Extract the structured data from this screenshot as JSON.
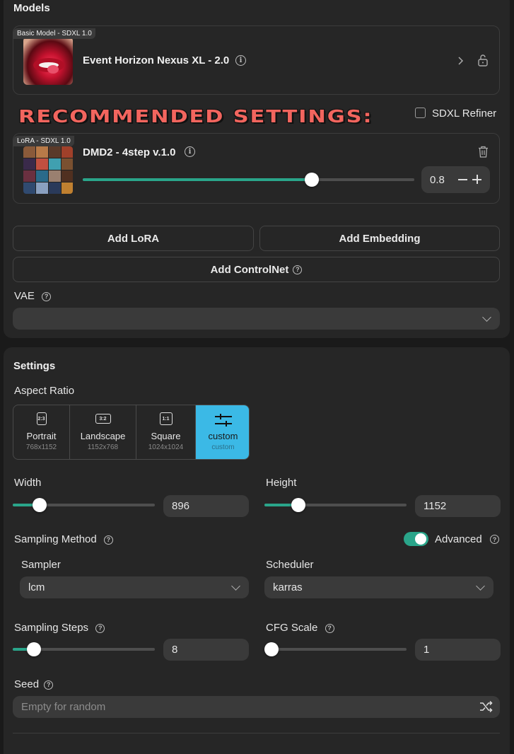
{
  "models": {
    "title": "Models",
    "base_model": {
      "tag": "Basic Model - SDXL 1.0",
      "name": "Event Horizon Nexus XL - 2.0"
    },
    "recommended_banner": "RECOMMENDED SETTINGS:",
    "sdxl_refiner": {
      "label": "SDXL Refiner",
      "checked": false
    },
    "lora": {
      "tag": "LoRA - SDXL 1.0",
      "name": "DMD2 - 4step v.1.0",
      "weight": "0.8",
      "slider_fraction": 0.69
    },
    "buttons": {
      "add_lora": "Add LoRA",
      "add_embedding": "Add Embedding",
      "add_controlnet": "Add ControlNet"
    },
    "vae": {
      "label": "VAE",
      "value": ""
    }
  },
  "settings": {
    "title": "Settings",
    "aspect_ratio": {
      "label": "Aspect Ratio",
      "options": [
        {
          "icon": "2:3",
          "name": "Portrait",
          "dims": "768x1152"
        },
        {
          "icon": "3:2",
          "name": "Landscape",
          "dims": "1152x768"
        },
        {
          "icon": "1:1",
          "name": "Square",
          "dims": "1024x1024"
        },
        {
          "icon": "sliders-icon",
          "name": "custom",
          "dims": "custom"
        }
      ],
      "selected": "custom"
    },
    "width": {
      "label": "Width",
      "value": "896",
      "slider_fraction": 0.19
    },
    "height": {
      "label": "Height",
      "value": "1152",
      "slider_fraction": 0.24
    },
    "sampling_method": {
      "label": "Sampling Method",
      "advanced_label": "Advanced",
      "advanced_on": true
    },
    "sampler": {
      "label": "Sampler",
      "value": "lcm"
    },
    "scheduler": {
      "label": "Scheduler",
      "value": "karras"
    },
    "sampling_steps": {
      "label": "Sampling Steps",
      "value": "8",
      "slider_fraction": 0.15
    },
    "cfg_scale": {
      "label": "CFG Scale",
      "value": "1",
      "slider_fraction": 0.0
    },
    "seed": {
      "label": "Seed",
      "placeholder": "Empty for random"
    }
  },
  "colors": {
    "accent": "#2aa58a",
    "selected_tile": "#3bb9e6",
    "banner": "#f2655e"
  }
}
